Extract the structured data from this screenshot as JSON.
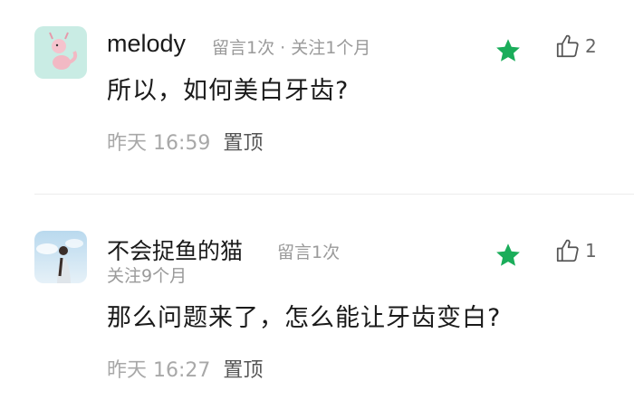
{
  "comments": [
    {
      "username": "melody",
      "meta": "留言1次 · 关注1个月",
      "meta2": "",
      "content": "所以，如何美白牙齿?",
      "time": "昨天 16:59",
      "pin_label": "置顶",
      "likes": "2",
      "starred": true
    },
    {
      "username": "不会捉鱼的猫",
      "meta": "留言1次",
      "meta2": "关注9个月",
      "content": "那么问题来了，怎么能让牙齿变白?",
      "time": "昨天 16:27",
      "pin_label": "置顶",
      "likes": "1",
      "starred": true
    }
  ],
  "colors": {
    "star": "#1aad5a",
    "meta_text": "#9a9a9a",
    "time_text": "#a8a8a8",
    "pin_text": "#555555"
  },
  "icons": [
    "star-icon",
    "thumbs-up-icon"
  ]
}
